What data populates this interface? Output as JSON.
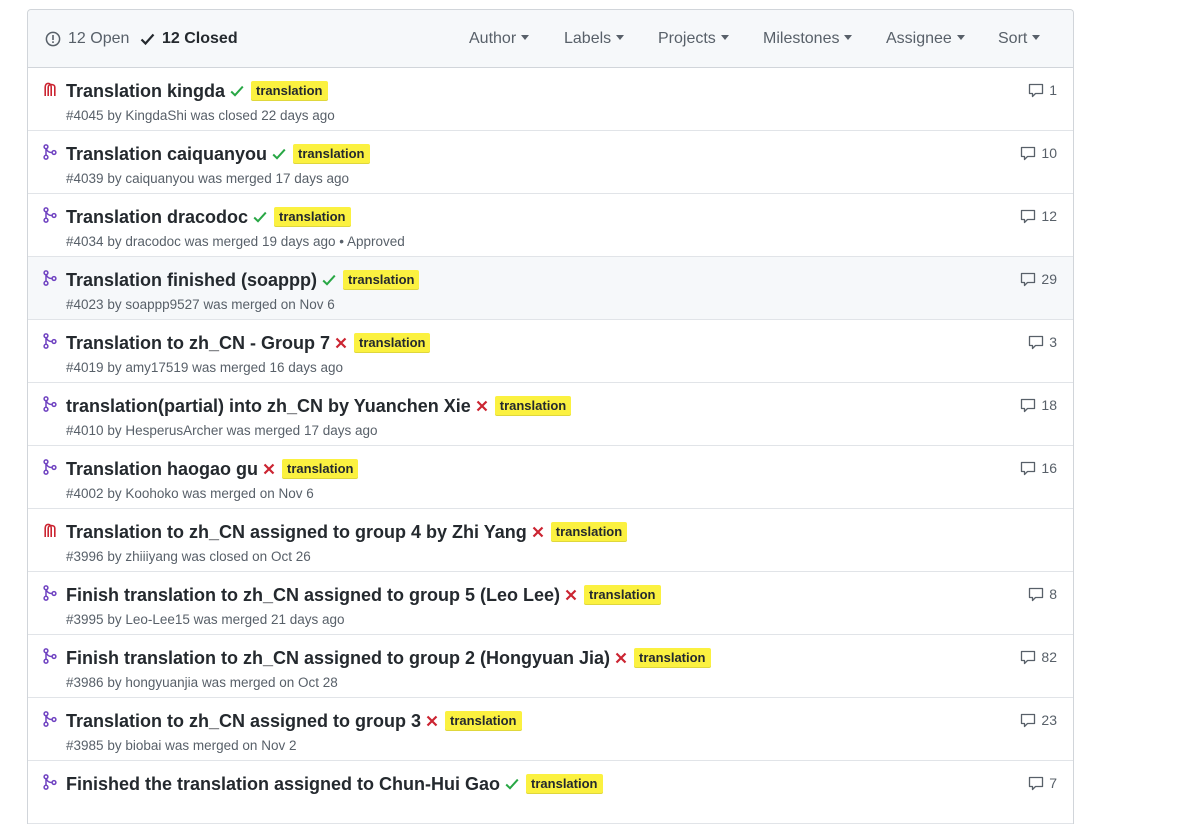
{
  "header": {
    "open": {
      "icon": "issue-opened-icon",
      "label": "12 Open"
    },
    "closed": {
      "icon": "check-icon",
      "label": "12 Closed"
    },
    "filters": [
      {
        "id": "author",
        "label": "Author"
      },
      {
        "id": "labels",
        "label": "Labels"
      },
      {
        "id": "projects",
        "label": "Projects"
      },
      {
        "id": "milestones",
        "label": "Milestones"
      },
      {
        "id": "assignee",
        "label": "Assignee"
      },
      {
        "id": "sort",
        "label": "Sort"
      }
    ]
  },
  "colors": {
    "merged": "#6f42c1",
    "closed": "#cb2431",
    "success": "#28a745",
    "failure": "#cb2431",
    "label_bg": "#fbf140"
  },
  "pull_requests": [
    {
      "state": "closed",
      "title": "Translation kingda",
      "ci": "success",
      "label": "translation",
      "number": "#4045",
      "author": "KingdaShi",
      "action": "was closed 22 days ago",
      "extra": "",
      "comments": "1"
    },
    {
      "state": "merged",
      "title": "Translation caiquanyou",
      "ci": "success",
      "label": "translation",
      "number": "#4039",
      "author": "caiquanyou",
      "action": "was merged 17 days ago",
      "extra": "",
      "comments": "10"
    },
    {
      "state": "merged",
      "title": "Translation dracodoc",
      "ci": "success",
      "label": "translation",
      "number": "#4034",
      "author": "dracodoc",
      "action": "was merged 19 days ago",
      "extra": "• Approved",
      "comments": "12"
    },
    {
      "state": "merged",
      "title": "Translation finished (soappp)",
      "ci": "success",
      "label": "translation",
      "number": "#4023",
      "author": "soappp9527",
      "action": "was merged on Nov 6",
      "extra": "",
      "comments": "29",
      "highlighted": true
    },
    {
      "state": "merged",
      "title": "Translation to zh_CN - Group 7",
      "ci": "failure",
      "label": "translation",
      "number": "#4019",
      "author": "amy17519",
      "action": "was merged 16 days ago",
      "extra": "",
      "comments": "3"
    },
    {
      "state": "merged",
      "title": "translation(partial) into zh_CN by Yuanchen Xie",
      "ci": "failure",
      "label": "translation",
      "number": "#4010",
      "author": "HesperusArcher",
      "action": "was merged 17 days ago",
      "extra": "",
      "comments": "18"
    },
    {
      "state": "merged",
      "title": "Translation haogao gu",
      "ci": "failure",
      "label": "translation",
      "number": "#4002",
      "author": "Koohoko",
      "action": "was merged on Nov 6",
      "extra": "",
      "comments": "16"
    },
    {
      "state": "closed",
      "title": "Translation to zh_CN assigned to group 4 by Zhi Yang",
      "ci": "failure",
      "label": "translation",
      "number": "#3996",
      "author": "zhiiiyang",
      "action": "was closed on Oct 26",
      "extra": "",
      "comments": ""
    },
    {
      "state": "merged",
      "title": "Finish translation to zh_CN assigned to group 5 (Leo Lee)",
      "ci": "failure",
      "label": "translation",
      "number": "#3995",
      "author": "Leo-Lee15",
      "action": "was merged 21 days ago",
      "extra": "",
      "comments": "8"
    },
    {
      "state": "merged",
      "title": "Finish translation to zh_CN assigned to group 2 (Hongyuan Jia)",
      "ci": "failure",
      "label": "translation",
      "number": "#3986",
      "author": "hongyuanjia",
      "action": "was merged on Oct 28",
      "extra": "",
      "comments": "82"
    },
    {
      "state": "merged",
      "title": "Translation to zh_CN assigned to group 3",
      "ci": "failure",
      "label": "translation",
      "number": "#3985",
      "author": "biobai",
      "action": "was merged on Nov 2",
      "extra": "",
      "comments": "23"
    },
    {
      "state": "merged",
      "title": "Finished the translation assigned to Chun-Hui Gao",
      "ci": "success",
      "label": "translation",
      "number": "",
      "author": "",
      "action": "",
      "extra": "",
      "comments": "7"
    }
  ]
}
